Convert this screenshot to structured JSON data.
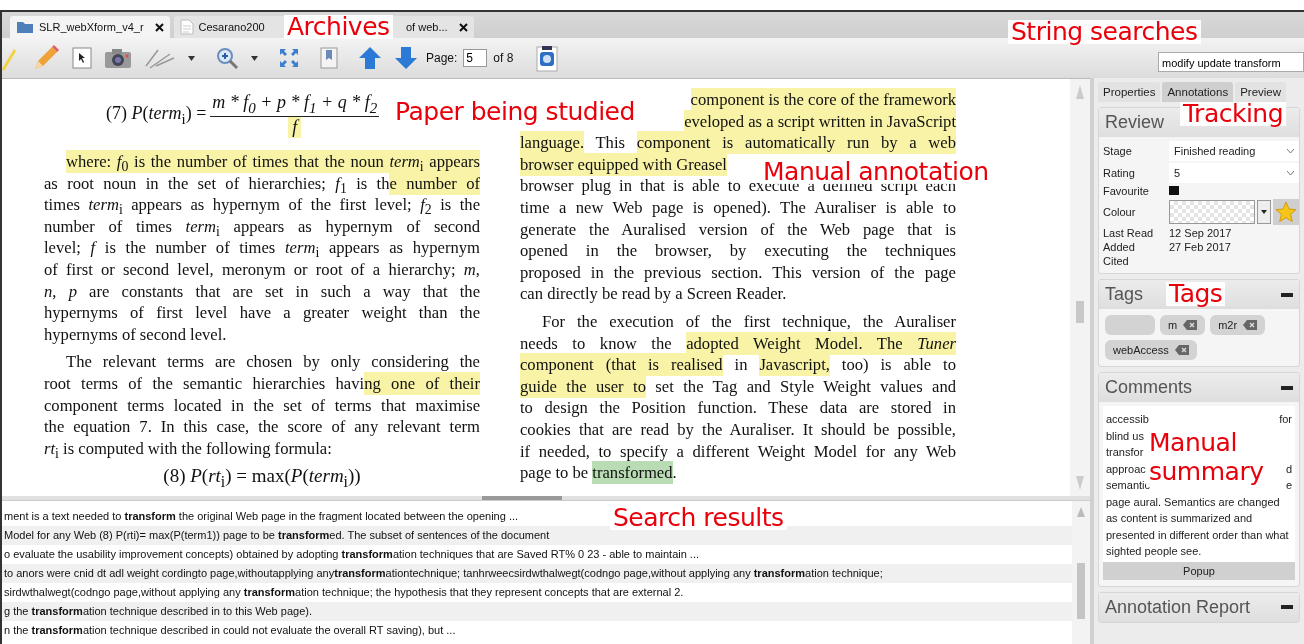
{
  "tabs": [
    {
      "kind": "folder",
      "label": "SLR_webXform_v4_r",
      "selected": true
    },
    {
      "kind": "document",
      "label": "Cesarano200",
      "label_tail": "of web...",
      "selected": false
    }
  ],
  "toolbar": {
    "page_label": "Page:",
    "page": "5",
    "page_total": "of 8"
  },
  "search": {
    "value": "modify update transform"
  },
  "document": {
    "equation_7": {
      "lhs": "(7) *P*(*term*$_{i}$) =",
      "numerator": [
        {
          "base": "m * f",
          "sub": "0"
        },
        {
          "base": " + p * f",
          "sub": "1"
        },
        {
          "base": " + q * f",
          "sub": "2"
        }
      ],
      "denominator": "f"
    },
    "left_paragraphs": [
      {
        "lines": [
          {
            "segments": [
              {
                "text": "where: *f*$_{0}$ is the number of times that the noun *term*$_{i}$ appears",
                "color": "#f8f3a6"
              }
            ]
          },
          {
            "segments": [
              {
                "text": "as root noun in the set of hierarchies; *f*$_{1}$ is th"
              },
              {
                "text": "e number of",
                "color": "#f8f3a6"
              }
            ]
          },
          {
            "segments": [
              {
                "text": "times *term*$_{i}$ appears as hypernym of the first level; *f*$_{2}$ is the"
              }
            ]
          },
          {
            "segments": [
              {
                "text": "number of times *term*$_{i}$ appears as hypernym of second"
              }
            ]
          },
          {
            "segments": [
              {
                "text": "level; *f* is the number of times *term*$_{i}$ appears as hypernym"
              }
            ]
          },
          {
            "segments": [
              {
                "text": "of first or second level, meronym or root of a hierarchy; *m*,"
              }
            ]
          },
          {
            "segments": [
              {
                "text": "*n*, *p* are constants that are set in such a way that the"
              }
            ]
          },
          {
            "segments": [
              {
                "text": "hypernyms of first level have a greater weight than the"
              }
            ]
          },
          {
            "segments": [
              {
                "text": "hypernyms of second level."
              }
            ]
          }
        ]
      },
      {
        "lines": [
          {
            "segments": [
              {
                "text": "The relevant terms are chosen by only considering the"
              }
            ]
          },
          {
            "segments": [
              {
                "text": "root terms of the semantic hierarchies havi"
              },
              {
                "text": "ng one of their",
                "color": "#f8f3a6"
              }
            ]
          },
          {
            "segments": [
              {
                "text": "component terms located in the set of terms that maximise"
              }
            ]
          },
          {
            "segments": [
              {
                "text": "the equation 7. In this case, the score of any relevant term"
              }
            ]
          },
          {
            "segments": [
              {
                "text": "*rt*$_{i}$ is computed with the following formula:"
              }
            ]
          }
        ]
      }
    ],
    "equation_8": "(8) *P*(*rt*$_{i}$) = max(*P*(*term*$_{i}$))",
    "right_paragraphs": [
      {
        "lines": [
          {
            "clipped_start": true,
            "segments": [
              {
                "text": "component is the core of the framework",
                "color": "#f8f3a6"
              }
            ]
          },
          {
            "clipped_start": true,
            "segments": [
              {
                "text": "eveloped as a script written in JavaScript",
                "color": "#f8f3a6"
              }
            ]
          },
          {
            "segments": [
              {
                "text": "language.",
                "color": "#f8f3a6"
              },
              {
                "text": " This "
              },
              {
                "text": "component is automatically run by a web",
                "color": "#f8f3a6"
              }
            ]
          },
          {
            "clipped_end": true,
            "segments": [
              {
                "text": "browser equipped with Greasel",
                "color": "#f8f3a6"
              }
            ]
          },
          {
            "segments": [
              {
                "text": "browser plug in that is able to execute a defined script each"
              }
            ]
          },
          {
            "segments": [
              {
                "text": "time a new Web page is opened). The Auraliser is able to"
              }
            ]
          },
          {
            "segments": [
              {
                "text": "generate the Auralised version of the Web page that is"
              }
            ]
          },
          {
            "segments": [
              {
                "text": "opened in the browser, by executing the techniques"
              }
            ]
          },
          {
            "segments": [
              {
                "text": "proposed in the previous section. This version of the page"
              }
            ]
          },
          {
            "segments": [
              {
                "text": "can directly be read by a Screen Reader."
              }
            ]
          }
        ]
      },
      {
        "lines": [
          {
            "segments": [
              {
                "text": "For the execution of the first technique, the Auraliser"
              }
            ]
          },
          {
            "segments": [
              {
                "text": "needs to know the "
              },
              {
                "text": "adopted Weight Model. The *Tuner*",
                "color": "#f8f3a6"
              }
            ]
          },
          {
            "segments": [
              {
                "text": "component (that is ",
                "color": "#f8f3a6"
              },
              {
                "text": "realised",
                "color": "#f8f3a6"
              },
              {
                "text": " in "
              },
              {
                "text": "Javascript,",
                "color": "#f8f3a6"
              },
              {
                "text": " too) is able to"
              }
            ]
          },
          {
            "segments": [
              {
                "text": "guide the user to",
                "color": "#f8f3a6"
              },
              {
                "text": " set the Tag and Style Weight values and"
              }
            ]
          },
          {
            "segments": [
              {
                "text": "to design the Position function. These data are stored in"
              }
            ]
          },
          {
            "segments": [
              {
                "text": "cookies that are read by the Auraliser. It should be possible,"
              }
            ]
          },
          {
            "segments": [
              {
                "text": "if needed, to specify a different Weight Model for any Web"
              }
            ]
          },
          {
            "segments": [
              {
                "text": "page to be "
              },
              {
                "text": "transformed",
                "color": "#b9dcb4"
              },
              {
                "text": "."
              }
            ]
          }
        ]
      }
    ]
  },
  "search_results": [
    "ment is a text needed to **transform** the original Web page in the fragment located between the opening ...",
    "Model for any Web (8) P(rti)= max(P(term1)) page to be **transform**ed. The subset of sentences of the document",
    "o evaluate the usability improvement concepts) obtained by adopting **transform**ation techniques that are Saved RT% 0 23 - able to maintain ...",
    "to anors were cnid dt adl weight cordingto page,withoutapplying any**transform**ationtechnique; tanhrweecsirdwthalwegt(codngo page,without applying any **transform**ation technique;",
    "sirdwthalwegt(codngo page,without applying any **transform**ation technique; the hypothesis that they represent concepts that are external 2.",
    "g the **transform**ation technique described in to this Web page).",
    "n the **transform**ation technique described in could not evaluate the overall RT saving), but ..."
  ],
  "panel_tabs": [
    {
      "label": "Properties",
      "selected": false
    },
    {
      "label": "Annotations",
      "selected": true
    },
    {
      "label": "Preview",
      "selected": false
    }
  ],
  "review": {
    "title": "Review",
    "fields": [
      {
        "kind": "dropdown",
        "label": "Stage",
        "value": "Finished reading"
      },
      {
        "kind": "dropdown",
        "label": "Rating",
        "value": "5"
      },
      {
        "kind": "checkbox",
        "label": "Favourite",
        "checked": true
      },
      {
        "kind": "colour",
        "label": "Colour"
      },
      {
        "kind": "text",
        "label": "Last Read",
        "value": "12 Sep 2017"
      },
      {
        "kind": "text",
        "label": "Added",
        "value": "27 Feb 2017"
      },
      {
        "kind": "text",
        "label": "Cited"
      }
    ]
  },
  "tags": {
    "title": "Tags",
    "items": [
      {
        "kind": "input"
      },
      {
        "kind": "tag",
        "label": "m"
      },
      {
        "kind": "tag",
        "label": "m2r"
      },
      {
        "kind": "tag",
        "label": "webAccess"
      }
    ]
  },
  "comments": {
    "title": "Comments",
    "lines": [
      {
        "start": "accessib",
        "end": "for"
      },
      {
        "start": "blind us"
      },
      {
        "start": "transfor"
      },
      {
        "start": "approac",
        "end": "d"
      },
      {
        "start": "semantic",
        "end": "e"
      }
    ],
    "text": "page aural. Semantics are changed as content is summarized and presented in different order than what sighted people see.",
    "button": "Popup"
  },
  "annotation_report": {
    "title": "Annotation Report"
  },
  "callouts": [
    "Archives",
    "String searches",
    "Paper being studied",
    "Tracking",
    "Manual annotation",
    "Tags",
    "Manual summary",
    "Search results"
  ]
}
